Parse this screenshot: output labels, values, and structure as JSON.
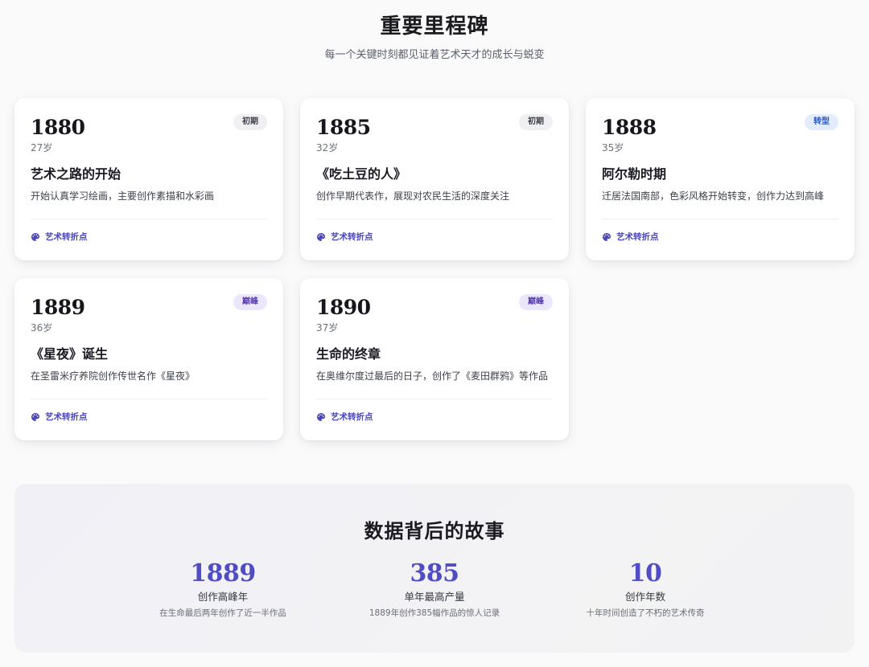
{
  "header": {
    "title": "重要里程碑",
    "subtitle": "每一个关键时刻都见证着艺术天才的成长与蜕变"
  },
  "milestones": [
    {
      "year": "1880",
      "age": "27岁",
      "badge": "初期",
      "title": "艺术之路的开始",
      "desc": "开始认真学习绘画，主要创作素描和水彩画",
      "tag": "艺术转折点"
    },
    {
      "year": "1885",
      "age": "32岁",
      "badge": "初期",
      "title": "《吃土豆的人》",
      "desc": "创作早期代表作，展现对农民生活的深度关注",
      "tag": "艺术转折点"
    },
    {
      "year": "1888",
      "age": "35岁",
      "badge": "转型",
      "title": "阿尔勒时期",
      "desc": "迁居法国南部，色彩风格开始转变，创作力达到高峰",
      "tag": "艺术转折点"
    },
    {
      "year": "1889",
      "age": "36岁",
      "badge": "巅峰",
      "title": "《星夜》诞生",
      "desc": "在圣雷米疗养院创作传世名作《星夜》",
      "tag": "艺术转折点"
    },
    {
      "year": "1890",
      "age": "37岁",
      "badge": "巅峰",
      "title": "生命的终章",
      "desc": "在奥维尔度过最后的日子，创作了《麦田群鸦》等作品",
      "tag": "艺术转折点"
    }
  ],
  "stats": {
    "title": "数据背后的故事",
    "items": [
      {
        "value": "1889",
        "label": "创作高峰年",
        "note": "在生命最后两年创作了近一半作品"
      },
      {
        "value": "385",
        "label": "单年最高产量",
        "note": "1889年创作385幅作品的惊人记录"
      },
      {
        "value": "10",
        "label": "创作年数",
        "note": "十年时间创造了不朽的艺术传奇"
      }
    ]
  },
  "icons": {
    "tag_icon": "palette-icon"
  },
  "colors": {
    "accent": "#4f4cc4",
    "badge_early_bg": "#f0f0f3",
    "badge_turn_bg": "#e3ecfd",
    "badge_peak_bg": "#ece6fb"
  }
}
